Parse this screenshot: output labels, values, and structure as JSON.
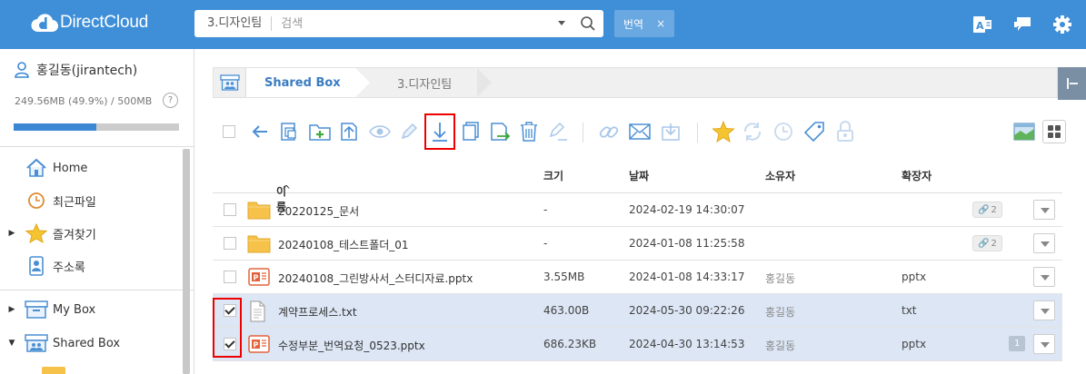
{
  "app": {
    "logo_text": "DirectCloud"
  },
  "search": {
    "location": "3.디자인팀",
    "placeholder": "검색"
  },
  "filter_tag": {
    "label": "번역",
    "close": "×"
  },
  "user": {
    "name": "홍길동(jirantech)",
    "quota_text": "249.56MB (49.9%) / 500MB",
    "quota_percent": 49.9,
    "help": "?"
  },
  "nav": [
    {
      "label": "Home",
      "icon": "home-icon",
      "arrow": ""
    },
    {
      "label": "최근파일",
      "icon": "clock-icon",
      "arrow": ""
    },
    {
      "label": "즐겨찾기",
      "icon": "star-icon",
      "arrow": "▶"
    },
    {
      "label": "주소록",
      "icon": "contacts-icon",
      "arrow": ""
    },
    {
      "label": "My Box",
      "icon": "box-icon",
      "arrow": "▶"
    },
    {
      "label": "Shared Box",
      "icon": "shared-box-icon",
      "arrow": "▼"
    }
  ],
  "breadcrumb": {
    "root": "Shared Box",
    "current": "3.디자인팀"
  },
  "table": {
    "headers": {
      "name": "이름",
      "sort": "^",
      "size": "크기",
      "date": "날짜",
      "owner": "소유자",
      "ext": "확장자"
    },
    "rows": [
      {
        "name": "20220125_문서",
        "size": "-",
        "date": "2024-02-19 14:30:07",
        "owner": "",
        "ext": "",
        "type": "folder",
        "selected": false,
        "links": "2",
        "comments": ""
      },
      {
        "name": "20240108_테스트폴더_01",
        "size": "-",
        "date": "2024-01-08 11:25:58",
        "owner": "",
        "ext": "",
        "type": "folder",
        "selected": false,
        "links": "2",
        "comments": ""
      },
      {
        "name": "20240108_그린방사서_스터디자료.pptx",
        "size": "3.55MB",
        "date": "2024-01-08 14:33:17",
        "owner": "홍길동",
        "ext": "pptx",
        "type": "pptx",
        "selected": false,
        "links": "",
        "comments": ""
      },
      {
        "name": "계약프로세스.txt",
        "size": "463.00B",
        "date": "2024-05-30 09:22:26",
        "owner": "홍길동",
        "ext": "txt",
        "type": "txt",
        "selected": true,
        "links": "",
        "comments": ""
      },
      {
        "name": "수정부분_번역요청_0523.pptx",
        "size": "686.23KB",
        "date": "2024-04-30 13:14:53",
        "owner": "홍길동",
        "ext": "pptx",
        "type": "pptx",
        "selected": true,
        "links": "",
        "comments": "1"
      }
    ]
  },
  "colors": {
    "topbar": "#3e8fd8",
    "accent": "#3a87d4",
    "selected_row": "#dce6f5",
    "highlight": "#e00000"
  }
}
